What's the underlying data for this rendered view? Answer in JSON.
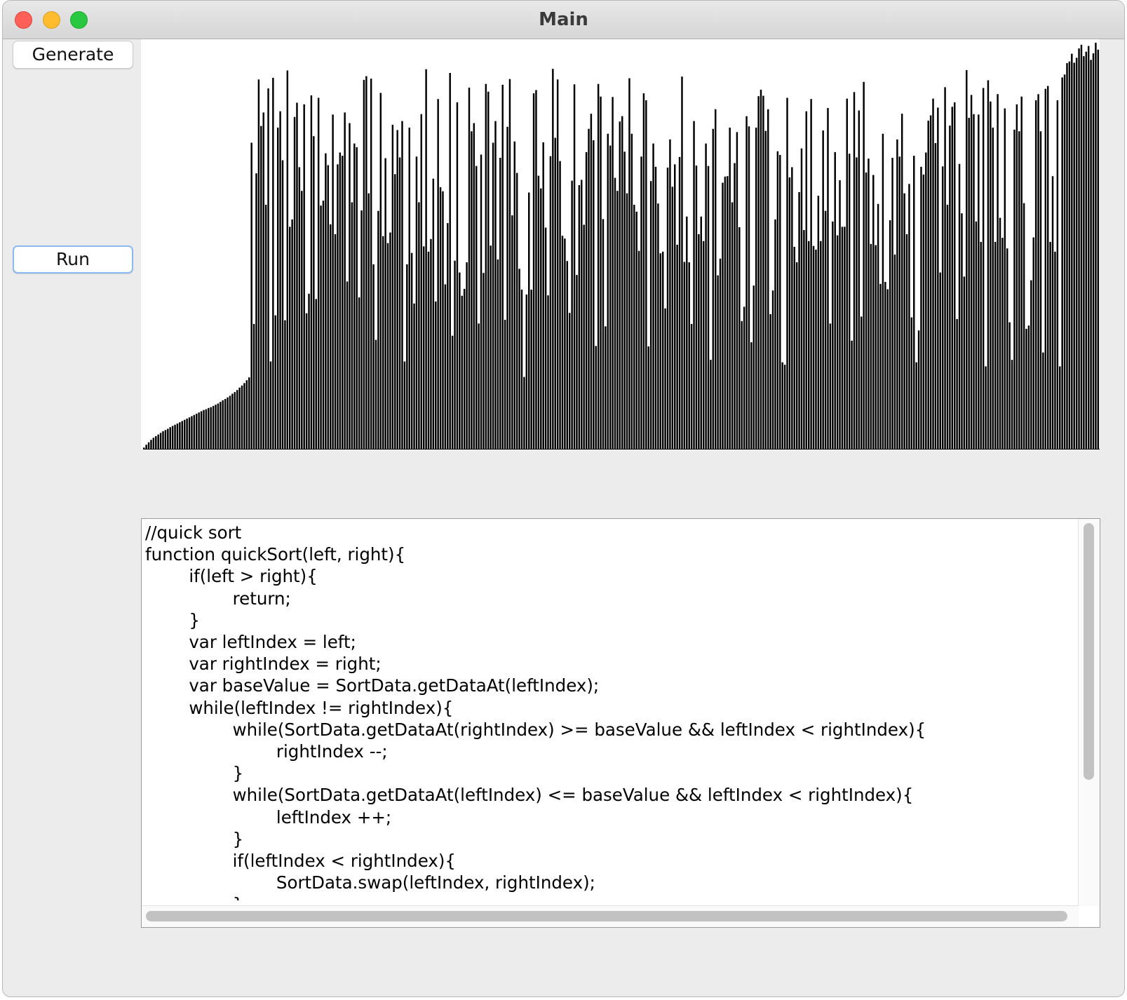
{
  "window": {
    "title": "Main"
  },
  "controls": {
    "generate_label": "Generate",
    "run_label": "Run"
  },
  "chart_data": {
    "type": "bar",
    "colors": {
      "bar": "#000000",
      "background": "#ffffff"
    },
    "ylim": [
      0,
      100
    ],
    "values": [
      0.3,
      1.0,
      1.6,
      2.2,
      2.7,
      3.1,
      3.5,
      3.9,
      4.3,
      4.6,
      4.9,
      5.3,
      5.6,
      5.9,
      6.2,
      6.5,
      6.8,
      7.1,
      7.4,
      7.7,
      8.0,
      8.3,
      8.6,
      8.9,
      9.2,
      9.5,
      9.7,
      10.0,
      10.2,
      10.5,
      10.8,
      11.1,
      11.5,
      11.9,
      12.2,
      12.6,
      13.0,
      13.5,
      13.9,
      14.4,
      15.0,
      15.5,
      16.1,
      16.8,
      17.5,
      75.0,
      30.6,
      67.5,
      90.5,
      79.1,
      82.4,
      59.8,
      88.3,
      21.4,
      90.9,
      32.7,
      78.7,
      82.7,
      70.7,
      31.5,
      92.7,
      54.4,
      56.2,
      81.3,
      84.8,
      69.0,
      63.2,
      84.4,
      33.2,
      38.0,
      86.6,
      76.6,
      36.7,
      86.0,
      59.6,
      60.8,
      72.4,
      69.5,
      55.0,
      81.9,
      52.6,
      69.7,
      72.6,
      71.8,
      82.4,
      41.0,
      79.8,
      60.4,
      74.8,
      73.9,
      37.1,
      58.4,
      90.4,
      91.3,
      62.6,
      90.7,
      45.2,
      26.7,
      58.3,
      87.2,
      52.1,
      71.2,
      50.4,
      53.0,
      79.4,
      67.3,
      78.1,
      71.4,
      80.3,
      21.4,
      45.2,
      78.7,
      48.0,
      35.6,
      71.6,
      60.4,
      82.0,
      49.6,
      93.0,
      48.3,
      51.4,
      66.2,
      36.1,
      85.7,
      64.1,
      63.1,
      40.3,
      55.3,
      92.1,
      27.7,
      46.1,
      84.9,
      43.2,
      37.5,
      39.2,
      45.7,
      88.5,
      77.8,
      79.8,
      69.3,
      30.7,
      72.1,
      43.1,
      89.4,
      87.5,
      49.8,
      75.0,
      80.3,
      46.4,
      71.3,
      89.2,
      31.6,
      78.9,
      90.6,
      57.2,
      75.3,
      67.6,
      44.1,
      39.0,
      17.6,
      37.8,
      62.8,
      39.0,
      87.1,
      87.9,
      66.9,
      63.8,
      75.1,
      54.2,
      37.6,
      71.7,
      93.1,
      76.2,
      90.5,
      70.5,
      52.2,
      51.5,
      46.0,
      33.3,
      65.7,
      89.3,
      42.6,
      64.6,
      65.9,
      54.9,
      72.7,
      78.4,
      82.1,
      75.6,
      25.2,
      89.4,
      86.3,
      56.3,
      30.0,
      77.2,
      74.3,
      86.2,
      66.4,
      63.2,
      80.2,
      81.5,
      72.8,
      62.6,
      90.8,
      77.2,
      59.8,
      58.1,
      48.5,
      71.6,
      87.1,
      85.4,
      25.1,
      65.6,
      74.8,
      69.1,
      60.1,
      47.9,
      48.3,
      34.4,
      68.9,
      75.8,
      64.2,
      69.7,
      50.0,
      71.5,
      91.2,
      45.8,
      56.9,
      45.7,
      30.6,
      80.3,
      69.4,
      52.6,
      56.9,
      50.9,
      74.8,
      69.3,
      21.8,
      78.4,
      83.2,
      42.5,
      46.6,
      65.2,
      66.7,
      66.8,
      78.7,
      60.4,
      70.0,
      77.6,
      54.3,
      31.3,
      34.8,
      81.5,
      79.0,
      26.1,
      40.0,
      78.7,
      86.4,
      88.0,
      86.5,
      77.9,
      83.2,
      33.0,
      38.8,
      56.2,
      72.9,
      72.0,
      21.2,
      20.6,
      86.0,
      66.5,
      69.0,
      49.5,
      45.7,
      62.9,
      73.6,
      53.6,
      82.7,
      50.9,
      85.7,
      49.7,
      48.8,
      62.0,
      50.9,
      78.0,
      58.3,
      83.5,
      30.7,
      55.7,
      72.7,
      52.3,
      65.8,
      54.4,
      54.4,
      85.8,
      72.3,
      26.5,
      87.4,
      71.4,
      82.9,
      32.4,
      89.9,
      67.7,
      71.1,
      50.2,
      67.1,
      49.9,
      60.0,
      40.4,
      77.2,
      40.9,
      39.1,
      56.0,
      71.3,
      47.6,
      75.8,
      71.6,
      82.1,
      62.6,
      52.6,
      64.9,
      32.2,
      71.8,
      21.2,
      29.0,
      69.1,
      67.2,
      72.6,
      80.4,
      81.7,
      85.8,
      74.9,
      83.6,
      43.2,
      69.2,
      88.6,
      59.8,
      79.2,
      83.8,
      84.9,
      31.8,
      69.8,
      57.7,
      42.2,
      92.8,
      81.1,
      86.7,
      82.0,
      55.7,
      81.9,
      50.7,
      88.4,
      20.2,
      90.3,
      85.1,
      78.7,
      50.7,
      86.9,
      56.6,
      51.7,
      83.4,
      49.1,
      31.0,
      21.8,
      78.2,
      84.4,
      77.8,
      86.3,
      60.2,
      29.4,
      30.2,
      41.3,
      51.8,
      85.4,
      86.9,
      77.8,
      23.6,
      88.2,
      88.9,
      50.7,
      66.8,
      48.3,
      85.4,
      20.2,
      91.0,
      91.7,
      94.5,
      94.9,
      96.8,
      94.6,
      95.8,
      98.1,
      99.0,
      96.2,
      97.3,
      98.7,
      95.3,
      96.9,
      99.5,
      97.8
    ]
  },
  "editor": {
    "lines": [
      "//quick sort",
      "function quickSort(left, right){",
      "\tif(left > right){",
      "\t\treturn;",
      "\t}",
      "\tvar leftIndex = left;",
      "\tvar rightIndex = right;",
      "\tvar baseValue = SortData.getDataAt(leftIndex);",
      "\twhile(leftIndex != rightIndex){",
      "\t\twhile(SortData.getDataAt(rightIndex) >= baseValue && leftIndex < rightIndex){",
      "\t\t\trightIndex --;",
      "\t\t}",
      "\t\twhile(SortData.getDataAt(leftIndex) <= baseValue && leftIndex < rightIndex){",
      "\t\t\tleftIndex ++;",
      "\t\t}",
      "\t\tif(leftIndex < rightIndex){",
      "\t\t\tSortData.swap(leftIndex, rightIndex);",
      "\t\t}"
    ]
  }
}
